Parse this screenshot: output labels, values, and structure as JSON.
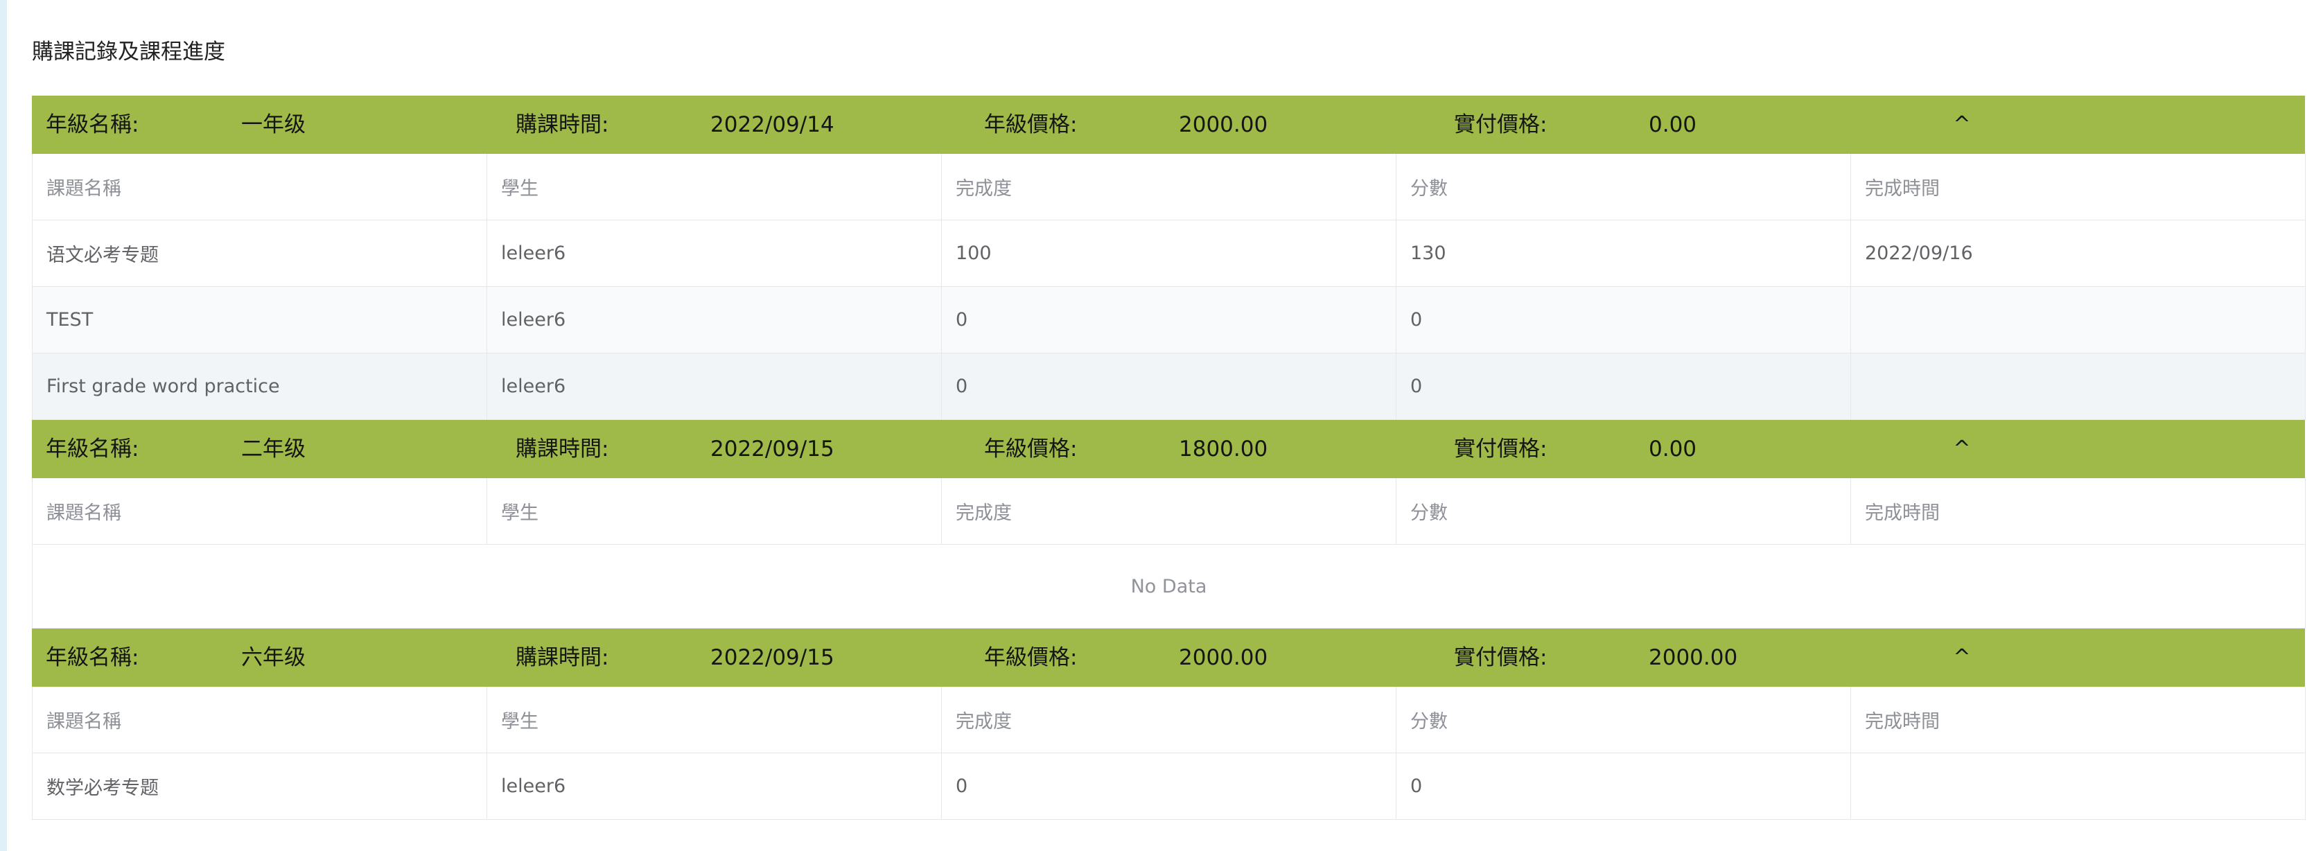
{
  "page_title": "購課記錄及課程進度",
  "header_labels": {
    "grade_name": "年級名稱:",
    "purchase_time": "購課時間:",
    "grade_price": "年級價格:",
    "paid_price": "實付價格:"
  },
  "table_columns": [
    "課題名稱",
    "學生",
    "完成度",
    "分數",
    "完成時間"
  ],
  "empty_text": "No Data",
  "toggle_icon": "chevron-up-icon",
  "grades": [
    {
      "grade_name": "一年级",
      "purchase_time": "2022/09/14",
      "grade_price": "2000.00",
      "paid_price": "0.00",
      "toggle_glyph": "^",
      "rows": [
        {
          "course": "语文必考专题",
          "student": "leleer6",
          "completion": "100",
          "score": "130",
          "completed_at": "2022/09/16"
        },
        {
          "course": "TEST",
          "student": "leleer6",
          "completion": "0",
          "score": "0",
          "completed_at": ""
        },
        {
          "course": "First grade word practice",
          "student": "leleer6",
          "completion": "0",
          "score": "0",
          "completed_at": ""
        }
      ]
    },
    {
      "grade_name": "二年级",
      "purchase_time": "2022/09/15",
      "grade_price": "1800.00",
      "paid_price": "0.00",
      "toggle_glyph": "^",
      "rows": []
    },
    {
      "grade_name": "六年级",
      "purchase_time": "2022/09/15",
      "grade_price": "2000.00",
      "paid_price": "2000.00",
      "toggle_glyph": "^",
      "rows": [
        {
          "course": "数学必考专题",
          "student": "leleer6",
          "completion": "0",
          "score": "0",
          "completed_at": ""
        }
      ]
    }
  ],
  "colors": {
    "header_bg": "#9fba48",
    "border": "#e5e7eb",
    "left_strip": "#dff0f8"
  }
}
